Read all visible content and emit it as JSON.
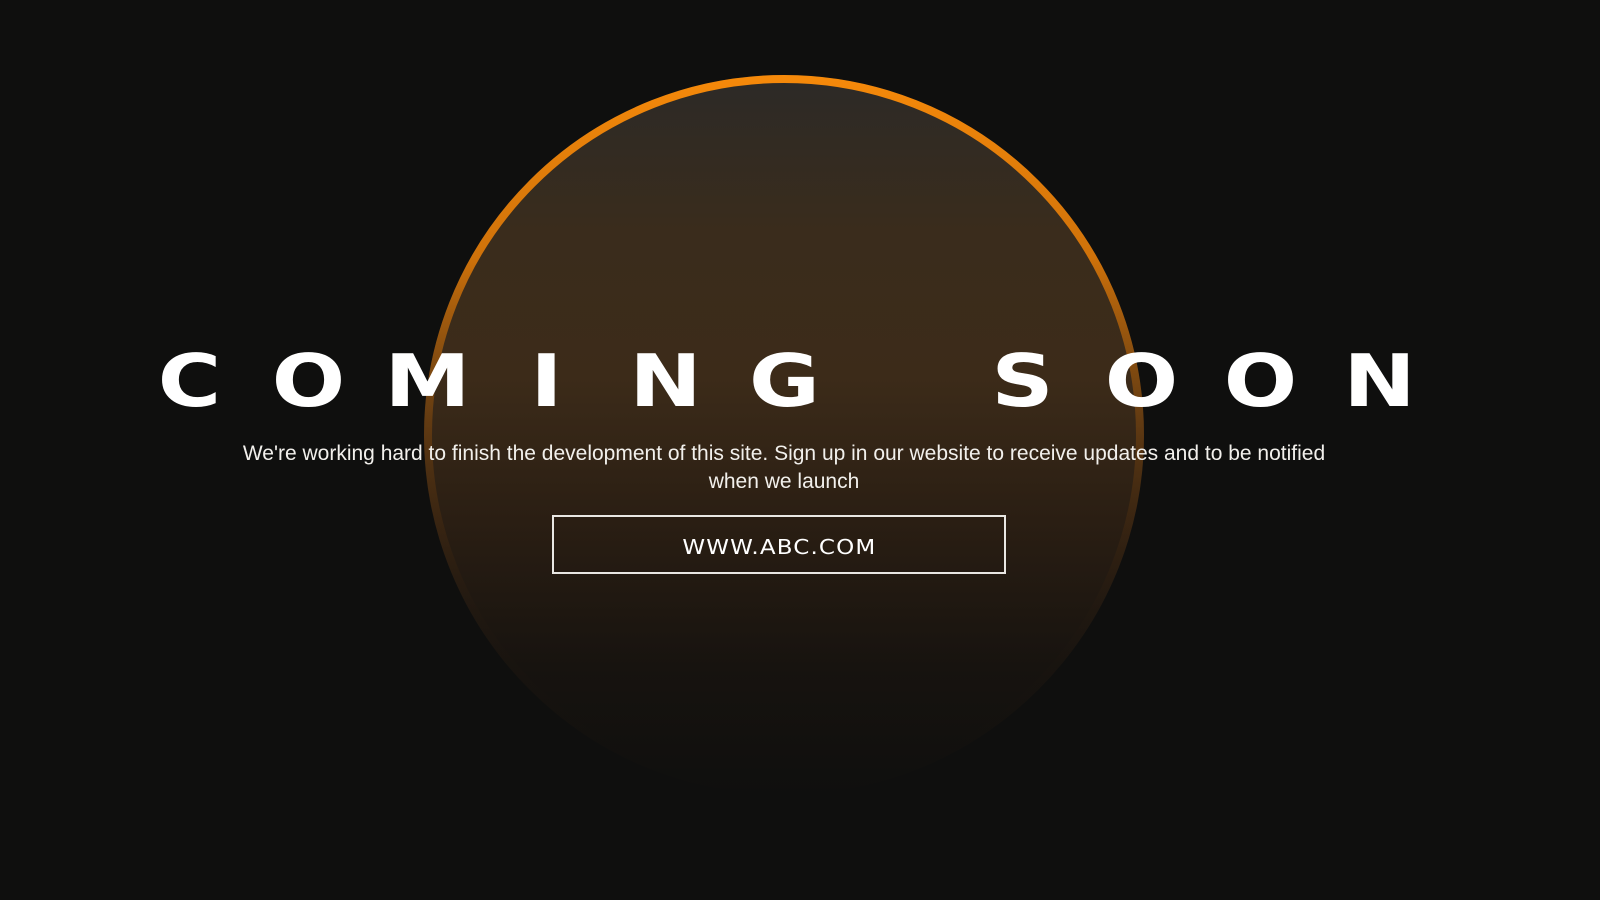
{
  "hero": {
    "title_letters": [
      "C",
      "O",
      "M",
      "I",
      "N",
      "G",
      "",
      "S",
      "O",
      "O",
      "N"
    ],
    "subtitle_line1": "We're working hard to finish the development of this site. Sign up in our website to receive updates and to be notified",
    "subtitle_line2": "when we launch",
    "cta_label": "WWW.ABC.COM"
  },
  "colors": {
    "background": "#0f0f0e",
    "accent": "#f5890a",
    "text": "#ffffff"
  }
}
